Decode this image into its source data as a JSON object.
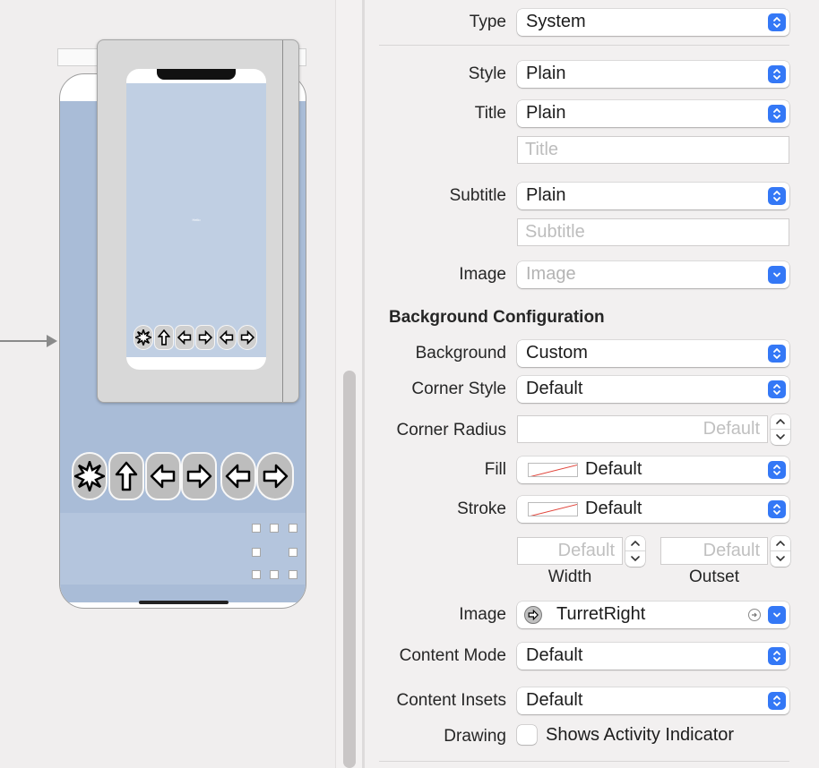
{
  "canvas": {
    "preview_tiny_text": "Hello"
  },
  "inspector": {
    "type": {
      "label": "Type",
      "value": "System"
    },
    "style": {
      "label": "Style",
      "value": "Plain"
    },
    "title": {
      "label": "Title",
      "value": "Plain",
      "placeholder": "Title"
    },
    "subtitle": {
      "label": "Subtitle",
      "value": "Plain",
      "placeholder": "Subtitle"
    },
    "image": {
      "label": "Image",
      "placeholder": "Image"
    },
    "background_section": "Background Configuration",
    "background": {
      "label": "Background",
      "value": "Custom"
    },
    "corner_style": {
      "label": "Corner Style",
      "value": "Default"
    },
    "corner_radius": {
      "label": "Corner Radius",
      "placeholder": "Default"
    },
    "fill": {
      "label": "Fill",
      "value": "Default"
    },
    "stroke": {
      "label": "Stroke",
      "value": "Default"
    },
    "stroke_width": {
      "label": "Width",
      "placeholder": "Default"
    },
    "stroke_outset": {
      "label": "Outset",
      "placeholder": "Default"
    },
    "bg_image": {
      "label": "Image",
      "value": "TurretRight"
    },
    "content_mode": {
      "label": "Content Mode",
      "value": "Default"
    },
    "content_insets": {
      "label": "Content Insets",
      "value": "Default"
    },
    "drawing": {
      "label": "Drawing",
      "checkbox_label": "Shows Activity Indicator",
      "checked": false
    }
  },
  "colors": {
    "accent": "#3478f6",
    "canvas_bg": "#f0eeee",
    "screen_bg": "#a9bcd7",
    "button_bg": "#bdbdbd"
  }
}
